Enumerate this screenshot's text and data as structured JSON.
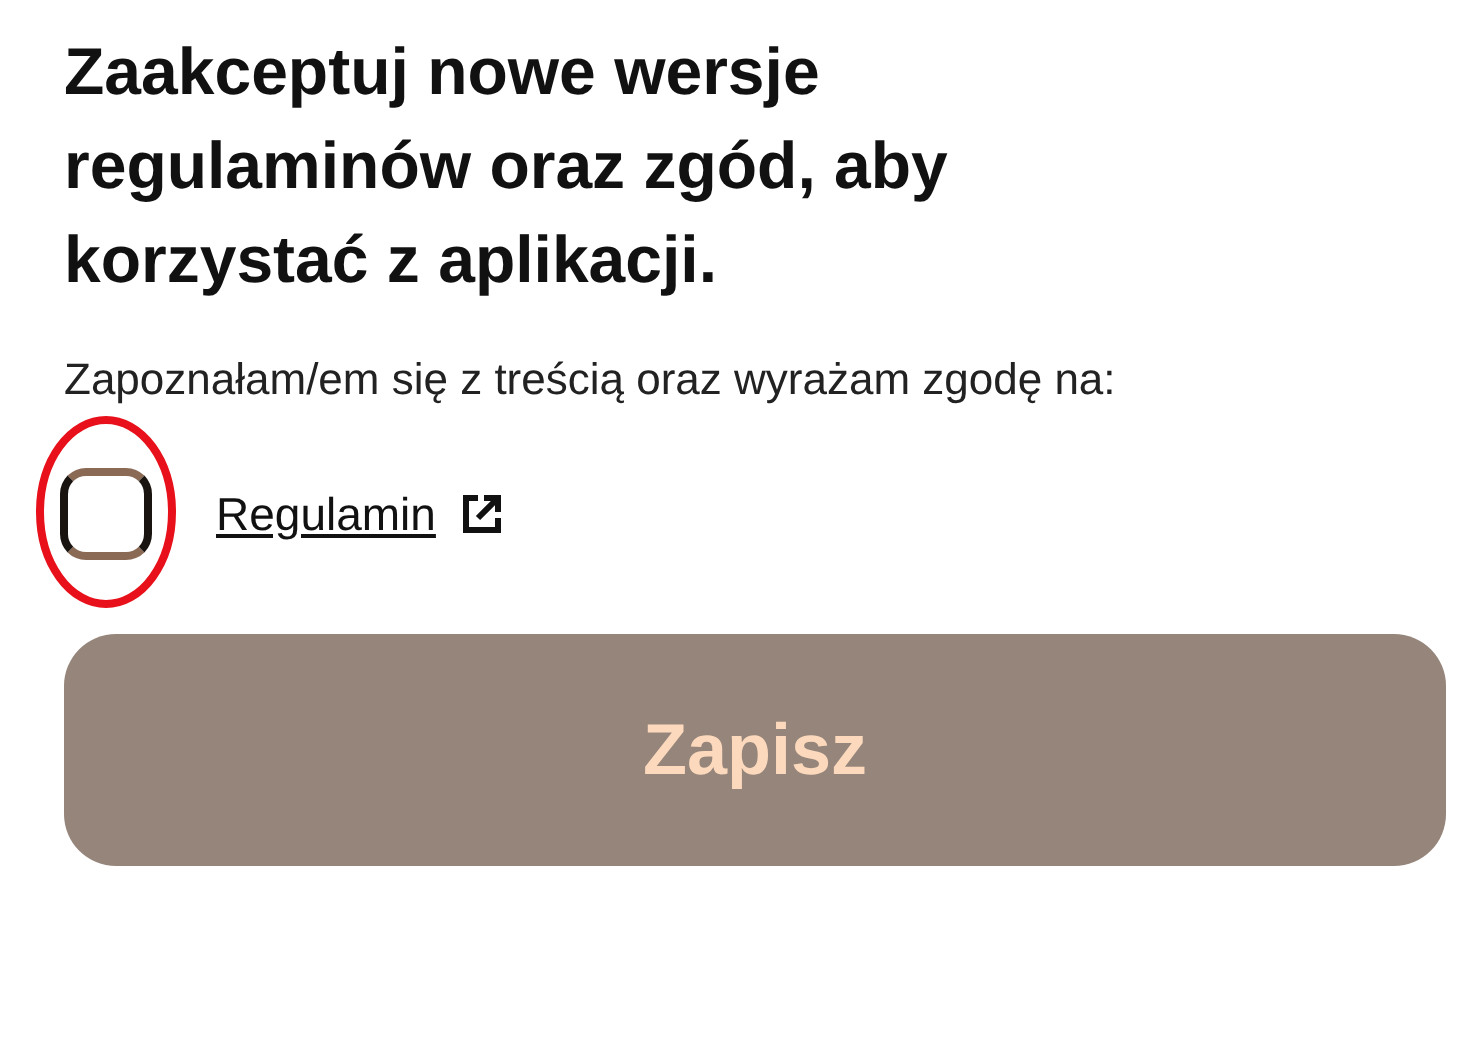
{
  "heading": "Zaakceptuj nowe wersje regulaminów oraz zgód, aby korzystać z aplikacji.",
  "intro": "Zapoznałam/em się z treścią oraz wyrażam zgodę na:",
  "consents": [
    {
      "label": "Regulamin",
      "checked": false,
      "highlighted": true,
      "external": true
    }
  ],
  "save_button": {
    "label": "Zapisz",
    "disabled": true
  }
}
